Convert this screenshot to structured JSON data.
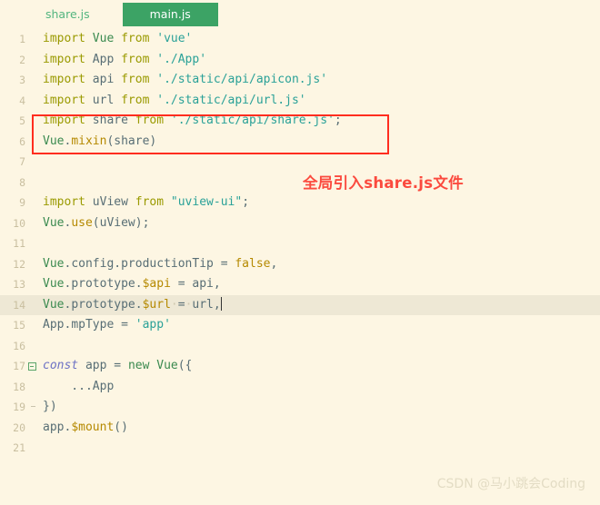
{
  "tabs": [
    {
      "label": "share.js",
      "active": false
    },
    {
      "label": "main.js",
      "active": true
    }
  ],
  "editor": {
    "active_line": 14,
    "lines": [
      {
        "number": "1",
        "text": "import Vue from 'vue'"
      },
      {
        "number": "2",
        "text": "import App from './App'"
      },
      {
        "number": "3",
        "text": "import api from './static/api/apicon.js'"
      },
      {
        "number": "4",
        "text": "import url from './static/api/url.js'"
      },
      {
        "number": "5",
        "text": "import share from './static/api/share.js';"
      },
      {
        "number": "6",
        "text": "Vue.mixin(share)"
      },
      {
        "number": "7",
        "text": ""
      },
      {
        "number": "8",
        "text": ""
      },
      {
        "number": "9",
        "text": "import uView from \"uview-ui\";"
      },
      {
        "number": "10",
        "text": "Vue.use(uView);"
      },
      {
        "number": "11",
        "text": ""
      },
      {
        "number": "12",
        "text": "Vue.config.productionTip = false,"
      },
      {
        "number": "13",
        "text": "Vue.prototype.$api = api,"
      },
      {
        "number": "14",
        "text": "Vue.prototype.$url = url,"
      },
      {
        "number": "15",
        "text": "App.mpType = 'app'"
      },
      {
        "number": "16",
        "text": ""
      },
      {
        "number": "17",
        "text": "const app = new Vue({"
      },
      {
        "number": "18",
        "text": "    ...App"
      },
      {
        "number": "19",
        "text": "})"
      },
      {
        "number": "20",
        "text": "app.$mount()"
      },
      {
        "number": "21",
        "text": ""
      }
    ]
  },
  "annotation": {
    "text": "全局引入share.js文件",
    "color": "#fb4a3e"
  },
  "highlight_box": {
    "color": "#ff2d1f",
    "covers_lines": "5-6"
  },
  "watermark": {
    "text": "CSDN @马小跳会Coding"
  },
  "colors": {
    "background": "#fdf6e3",
    "active_tab_bg": "#3ca365",
    "inactive_tab_text": "#53b57f",
    "current_line_bg": "#eee8d5",
    "gutter_text": "#c9bfa0"
  }
}
